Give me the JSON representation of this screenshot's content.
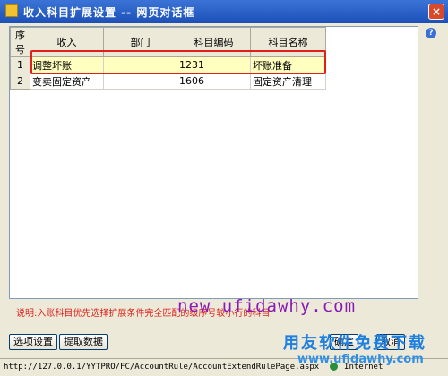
{
  "window": {
    "title": "收入科目扩展设置 -- 网页对话框",
    "close_label": "×",
    "help_label": "?"
  },
  "grid": {
    "headers": [
      "序号",
      "收入",
      "部门",
      "科目编码",
      "科目名称"
    ],
    "rows": [
      {
        "index": "1",
        "income": "调整坏账",
        "dept": "",
        "code": "1231",
        "name": "坏账准备"
      },
      {
        "index": "2",
        "income": "变卖固定资产",
        "dept": "",
        "code": "1606",
        "name": "固定资产清理"
      }
    ]
  },
  "note": "说明:入账科目优先选择扩展条件完全匹配的级序号较小行的科目",
  "buttons": {
    "select": "选项设置",
    "fetch": "提取数据",
    "confirm": "确定",
    "cancel": "取消"
  },
  "statusbar": {
    "url": "http://127.0.0.1/YYTPRO/FC/AccountRule/AccountExtendRulePage.aspx",
    "zone": "Internet"
  },
  "watermark": {
    "url": "new ufidawhy.com",
    "slogan": "用友软件免费下载",
    "site": "www.ufidawhy.com"
  }
}
